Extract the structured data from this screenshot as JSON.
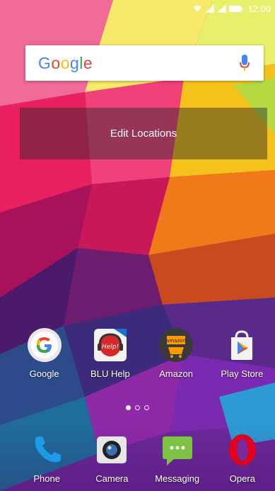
{
  "status_bar": {
    "time": "12:00",
    "icons": [
      "wifi-icon",
      "signal-icon",
      "signal-icon",
      "battery-icon"
    ]
  },
  "search": {
    "logo_text": "Google",
    "logo_colors": [
      "#4285F4",
      "#EA4335",
      "#FBBC05",
      "#4285F4",
      "#34A853",
      "#EA4335"
    ],
    "mic_icon": "mic-icon"
  },
  "weather_widget": {
    "label": "Edit Locations"
  },
  "apps": [
    {
      "label": "Google",
      "icon": "google-app-icon"
    },
    {
      "label": "BLU Help",
      "icon": "blu-help-icon"
    },
    {
      "label": "Amazon",
      "icon": "amazon-icon"
    },
    {
      "label": "Play Store",
      "icon": "play-store-icon"
    }
  ],
  "page_indicator": {
    "pages": 3,
    "current": 1
  },
  "dock": [
    {
      "label": "Phone",
      "icon": "phone-icon"
    },
    {
      "label": "Camera",
      "icon": "camera-icon"
    },
    {
      "label": "Messaging",
      "icon": "messaging-icon"
    },
    {
      "label": "Opera",
      "icon": "opera-icon"
    }
  ]
}
